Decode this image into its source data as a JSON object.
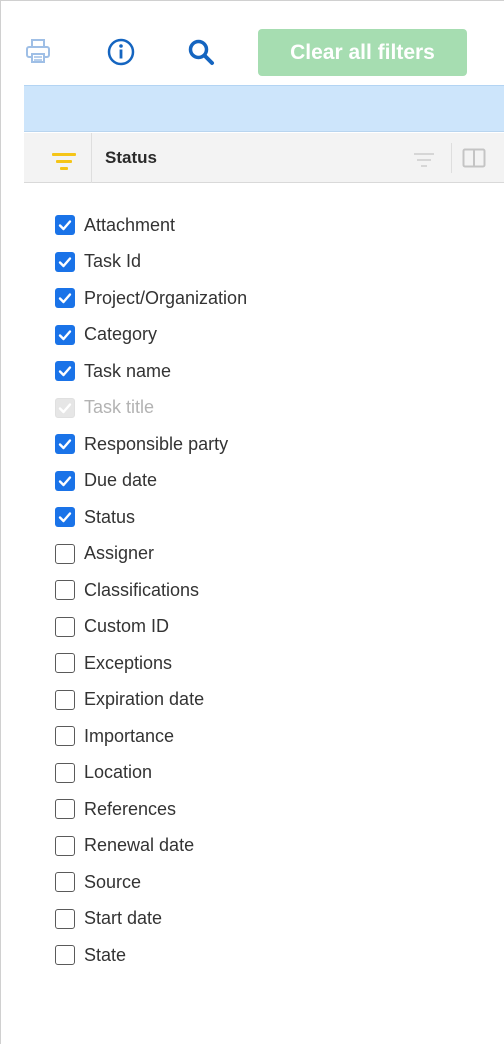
{
  "toolbar": {
    "clear_label": "Clear all filters",
    "icons": [
      "print-icon",
      "info-icon",
      "search-icon"
    ]
  },
  "column_header": {
    "label": "Status",
    "icons": [
      "filter-active-icon",
      "filter-icon",
      "columns-icon"
    ]
  },
  "columns": [
    {
      "label": "Attachment",
      "state": "checked"
    },
    {
      "label": "Task Id",
      "state": "checked"
    },
    {
      "label": "Project/Organization",
      "state": "checked"
    },
    {
      "label": "Category",
      "state": "checked"
    },
    {
      "label": "Task name",
      "state": "checked"
    },
    {
      "label": "Task title",
      "state": "disabled"
    },
    {
      "label": "Responsible party",
      "state": "checked"
    },
    {
      "label": "Due date",
      "state": "checked"
    },
    {
      "label": "Status",
      "state": "checked"
    },
    {
      "label": "Assigner",
      "state": "unchecked"
    },
    {
      "label": "Classifications",
      "state": "unchecked"
    },
    {
      "label": "Custom ID",
      "state": "unchecked"
    },
    {
      "label": "Exceptions",
      "state": "unchecked"
    },
    {
      "label": "Expiration date",
      "state": "unchecked"
    },
    {
      "label": "Importance",
      "state": "unchecked"
    },
    {
      "label": "Location",
      "state": "unchecked"
    },
    {
      "label": "References",
      "state": "unchecked"
    },
    {
      "label": "Renewal date",
      "state": "unchecked"
    },
    {
      "label": "Source",
      "state": "unchecked"
    },
    {
      "label": "Start date",
      "state": "unchecked"
    },
    {
      "label": "State",
      "state": "unchecked"
    }
  ],
  "colors": {
    "accent": "#1a73e8",
    "clear_button": "#a6ddb1",
    "band": "#cde5fb",
    "filter_active": "#f5c518"
  }
}
